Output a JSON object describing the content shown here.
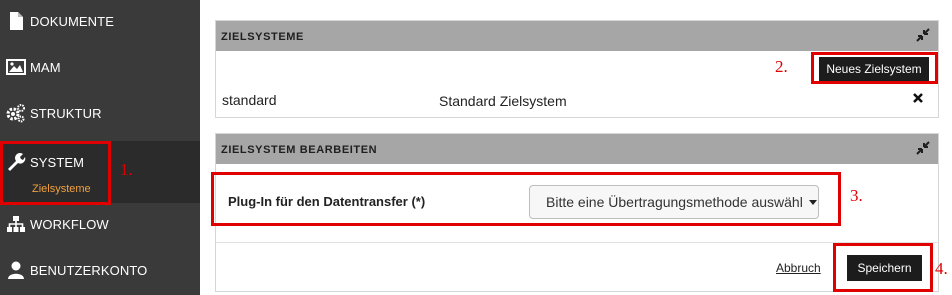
{
  "sidebar": {
    "items": [
      {
        "label": "DOKUMENTE",
        "icon": "document-icon"
      },
      {
        "label": "MAM",
        "icon": "image-icon"
      },
      {
        "label": "STRUKTUR",
        "icon": "gears-icon"
      },
      {
        "label": "SYSTEM",
        "icon": "wrench-icon",
        "sub": "Zielsysteme"
      },
      {
        "label": "WORKFLOW",
        "icon": "sitemap-icon"
      },
      {
        "label": "BENUTZERKONTO",
        "icon": "user-icon"
      }
    ]
  },
  "zielsysteme_panel": {
    "title": "ZIELSYSTEME",
    "new_button": "Neues Zielsystem",
    "row": {
      "name": "standard",
      "description": "Standard Zielsystem"
    }
  },
  "edit_panel": {
    "title": "ZIELSYSTEM BEARBEITEN",
    "plugin_label": "Plug-In für den Datentransfer (*)",
    "plugin_select_value": "Bitte eine Übertragungsmethode auswählen",
    "cancel_link": "Abbruch",
    "save_button": "Speichern"
  },
  "annotations": [
    "1.",
    "2.",
    "3.",
    "4."
  ],
  "colors": {
    "sidebar_bg": "#3a3a3a",
    "panel_head": "#a6a6a6",
    "annotation_red": "#e00000",
    "submenu_orange": "#f0a040"
  }
}
